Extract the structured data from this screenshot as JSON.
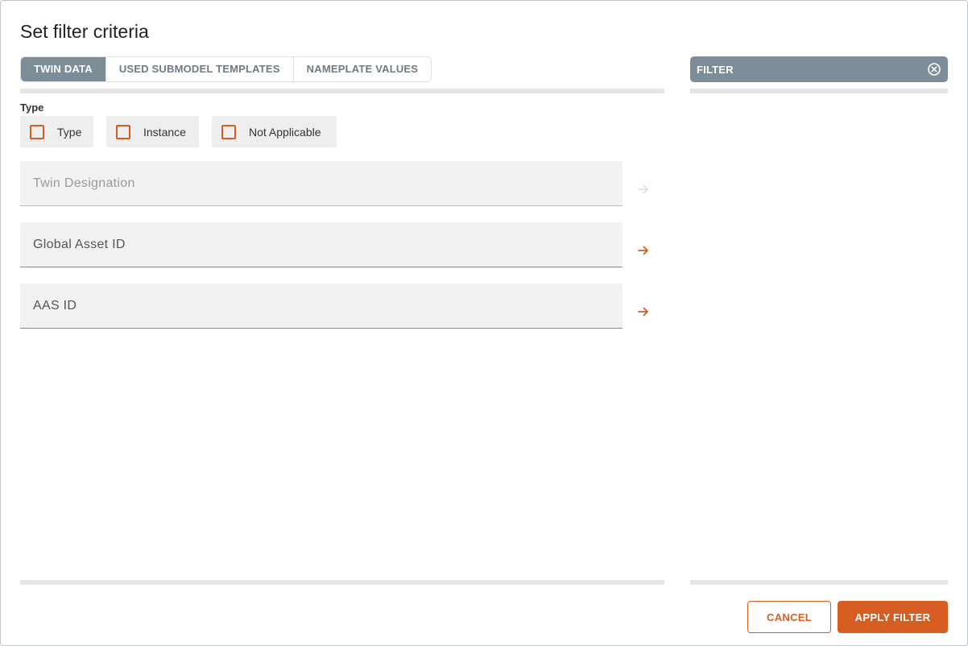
{
  "dialog": {
    "title": "Set filter criteria"
  },
  "tabs": [
    {
      "label": "TWIN DATA",
      "active": true
    },
    {
      "label": "USED SUBMODEL TEMPLATES",
      "active": false
    },
    {
      "label": "NAMEPLATE VALUES",
      "active": false
    }
  ],
  "type_group": {
    "label": "Type",
    "options": [
      {
        "label": "Type",
        "checked": false
      },
      {
        "label": "Instance",
        "checked": false
      },
      {
        "label": "Not Applicable",
        "checked": false
      }
    ]
  },
  "fields": {
    "twin_designation": {
      "placeholder": "Twin Designation",
      "value": "",
      "disabled": true
    },
    "global_asset_id": {
      "placeholder": "Global Asset ID",
      "value": ""
    },
    "aas_id": {
      "placeholder": "AAS ID",
      "value": ""
    }
  },
  "filter_panel": {
    "label": "FILTER",
    "clear_icon": "close-circle-icon"
  },
  "actions": {
    "cancel_label": "CANCEL",
    "apply_label": "APPLY FILTER"
  },
  "colors": {
    "accent": "#d65e22",
    "tab_active_bg": "#7d8d98",
    "field_bg": "#f2f2f2"
  },
  "icons": {
    "submit": "arrow-right-icon"
  }
}
